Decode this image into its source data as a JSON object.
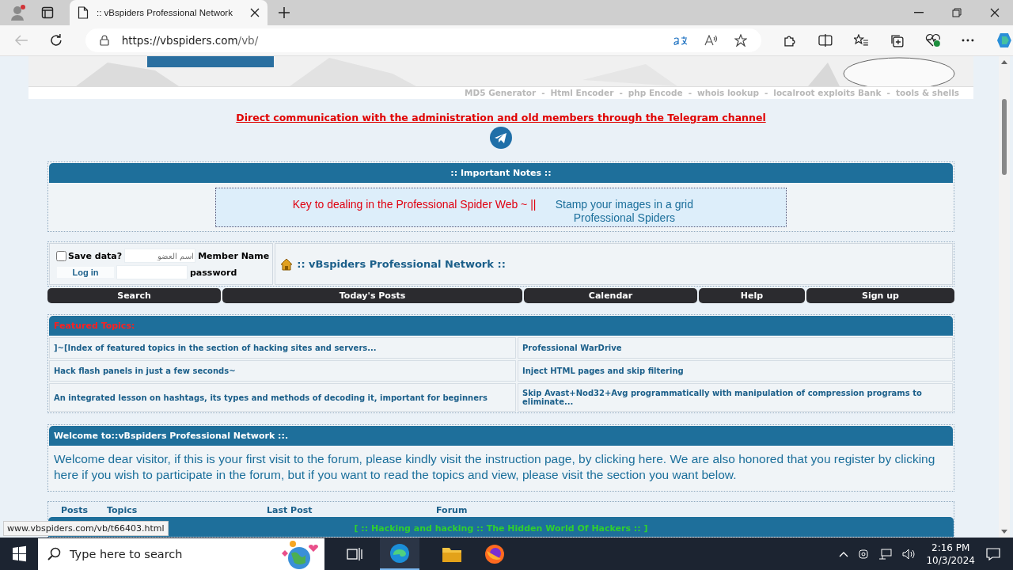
{
  "browser": {
    "tab_title": ":: vBspiders Professional Network",
    "url_host": "https://vbspiders.com",
    "url_path": "/vb/"
  },
  "header": {
    "tool_links": [
      "MD5 Generator",
      "Html Encoder",
      "php Encode",
      "whois lookup",
      "localroot exploits Bank",
      "tools & shells"
    ],
    "separator": "-"
  },
  "telegram": {
    "text": "Direct communication with the administration and old members through the Telegram channel"
  },
  "notes": {
    "title": ":: Important Notes ::",
    "red_link": "Key to dealing in the Professional Spider Web ~ ||",
    "blue_link": "Stamp your images in a grid Professional Spiders"
  },
  "login": {
    "save_label": "Save data?",
    "save_checked": false,
    "username_placeholder": "اسم العضو",
    "username_label": "Member Name",
    "login_button": "Log in",
    "password_label": "password",
    "site_link": ":: vBspiders Professional Network ::"
  },
  "navbar": [
    "Search",
    "Today's Posts",
    "Calendar",
    "Help",
    "Sign up"
  ],
  "featured": {
    "title": "Featured Topics:",
    "items": [
      {
        "text": "]~[Index of featured topics in the section of hacking sites and servers..."
      },
      {
        "text": "Professional WarDrive"
      },
      {
        "text": "Hack flash panels in just a few seconds~"
      },
      {
        "text": "Inject HTML pages and skip filtering"
      },
      {
        "text": "An integrated lesson on hashtags, its types and methods of decoding it, important for beginners"
      },
      {
        "text": "Skip Avast+Nod32+Avg programmatically with manipulation of compression programs to eliminate..."
      }
    ]
  },
  "welcome": {
    "title": "Welcome to::vBspiders Professional Network ::.",
    "text": "Welcome dear visitor, if this is your first visit to the forum, please kindly visit the instruction page, by clicking here. We are also honored that you register by clicking here if you wish to participate in the forum, but if you want to read the topics and view, please visit the section you want below."
  },
  "forum_table": {
    "columns": [
      "Posts",
      "Topics",
      "Last Post",
      "Forum"
    ],
    "category": "[ :: Hacking and hacking :: The Hidden World Of Hackers :: ]"
  },
  "status_url": "www.vbspiders.com/vb/t66403.html",
  "taskbar": {
    "search_placeholder": "Type here to search",
    "time": "2:16 PM",
    "date": "10/3/2024"
  }
}
